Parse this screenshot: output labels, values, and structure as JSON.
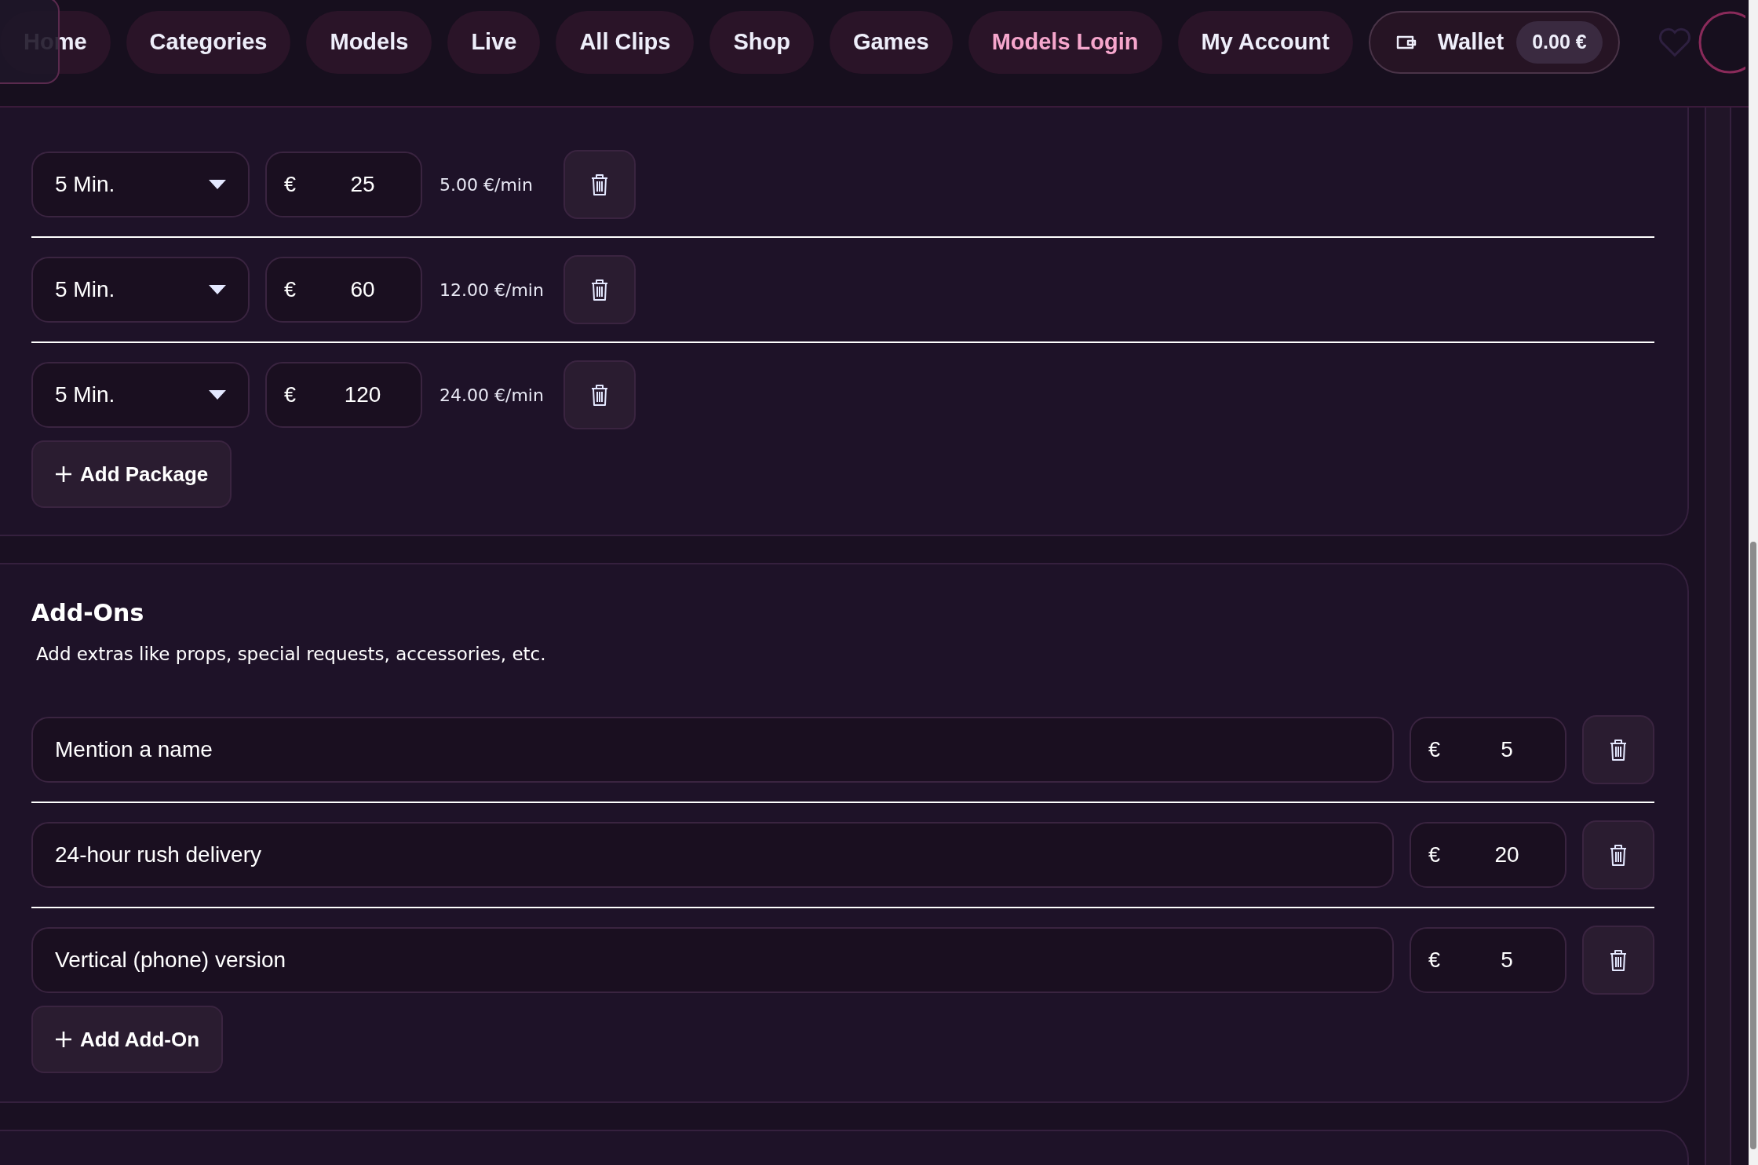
{
  "nav": {
    "items": [
      {
        "label": "Home",
        "highlighted": false
      },
      {
        "label": "Categories",
        "highlighted": false
      },
      {
        "label": "Models",
        "highlighted": false
      },
      {
        "label": "Live",
        "highlighted": false
      },
      {
        "label": "All Clips",
        "highlighted": false
      },
      {
        "label": "Shop",
        "highlighted": false
      },
      {
        "label": "Games",
        "highlighted": false
      },
      {
        "label": "Models Login",
        "highlighted": true
      },
      {
        "label": "My Account",
        "highlighted": false
      }
    ],
    "wallet": {
      "label": "Wallet",
      "balance": "0.00 €"
    }
  },
  "packages": {
    "rows": [
      {
        "duration": "5 Min.",
        "currency": "€",
        "price": "25",
        "rate": "5.00 €/min"
      },
      {
        "duration": "5 Min.",
        "currency": "€",
        "price": "60",
        "rate": "12.00 €/min"
      },
      {
        "duration": "5 Min.",
        "currency": "€",
        "price": "120",
        "rate": "24.00 €/min"
      }
    ],
    "add_button": "Add Package"
  },
  "addons": {
    "title": "Add-Ons",
    "description": "Add extras like props, special requests, accessories, etc.",
    "rows": [
      {
        "name": "Mention a name",
        "currency": "€",
        "price": "5"
      },
      {
        "name": "24-hour rush delivery",
        "currency": "€",
        "price": "20"
      },
      {
        "name": "Vertical (phone) version",
        "currency": "€",
        "price": "5"
      }
    ],
    "add_button": "Add Add-On"
  }
}
